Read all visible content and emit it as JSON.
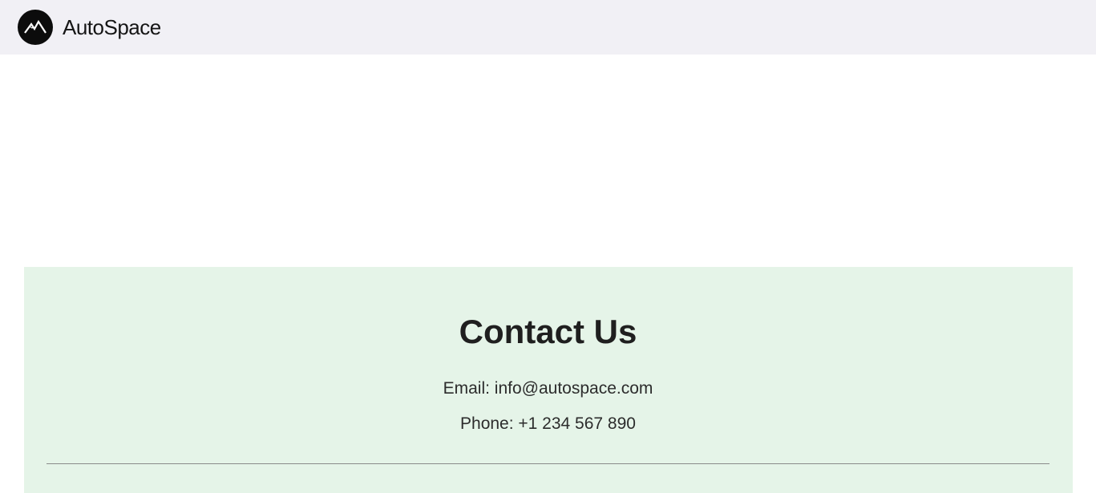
{
  "header": {
    "brand": "AutoSpace",
    "logo_icon": "mountain-logo-icon",
    "background": "#f1f0f5"
  },
  "contact": {
    "title": "Contact Us",
    "email_line": "Email: info@autospace.com",
    "phone_line": "Phone: +1 234 567 890",
    "background": "#e5f4e8"
  }
}
